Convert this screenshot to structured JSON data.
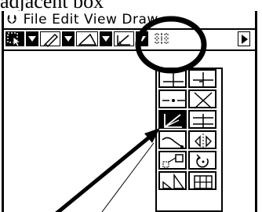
{
  "caption": "adjacent  box",
  "menubar": {
    "menu_icon": "menu-chevron-icon",
    "items": [
      "File",
      "Edit",
      "View",
      "Draw"
    ]
  },
  "toolbar": {
    "tools": [
      "select-icon",
      "pencil-icon",
      "triangle-icon",
      "angle-measure-icon",
      "grid-icon"
    ],
    "more_arrow": "scroll-right-icon"
  },
  "flyout": {
    "tools": [
      "perpendicular-icon",
      "perpendicular-bisector-icon",
      "midpoint-icon",
      "intersection-icon",
      "angle-bisector-icon",
      "parallel-icon",
      "tangent-icon",
      "reflection-icon",
      "translation-icon",
      "rotation-icon",
      "dilation-icon",
      "table-icon"
    ],
    "active_index": 4
  },
  "annotations": {
    "circle_color": "#000000",
    "arrow_color": "#000000"
  }
}
